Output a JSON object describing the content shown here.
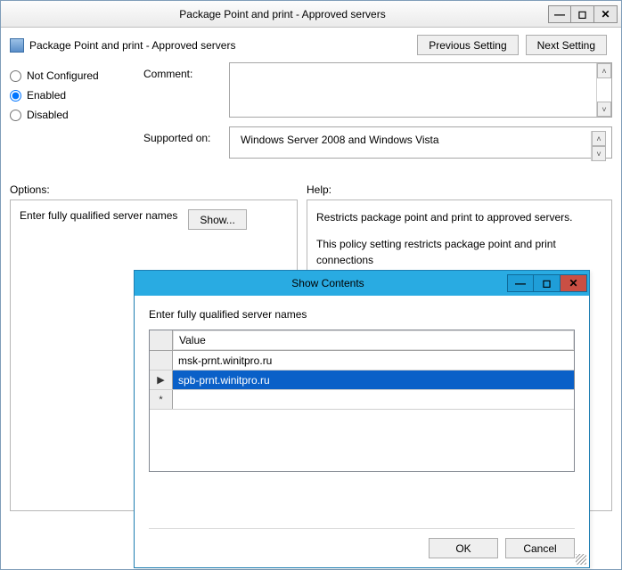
{
  "gpWindow": {
    "title": "Package Point and print - Approved servers",
    "settingName": "Package Point and print - Approved servers",
    "prevBtn": "Previous Setting",
    "nextBtn": "Next Setting",
    "radios": {
      "notConfigured": "Not Configured",
      "enabled": "Enabled",
      "disabled": "Disabled",
      "selected": "enabled"
    },
    "commentLabel": "Comment:",
    "commentValue": "",
    "supportedLabel": "Supported on:",
    "supportedValue": "Windows Server 2008 and Windows Vista",
    "optionsLabel": "Options:",
    "helpLabel": "Help:",
    "optionText": "Enter fully qualified server names",
    "showBtn": "Show...",
    "helpText1": "Restricts package point and print to approved servers.",
    "helpText2": "This policy setting restricts package point and print connections"
  },
  "modal": {
    "title": "Show Contents",
    "prompt": "Enter fully qualified server names",
    "columnHeader": "Value",
    "rows": [
      {
        "marker": "",
        "value": "msk-prnt.winitpro.ru",
        "selected": false
      },
      {
        "marker": "▶",
        "value": "spb-prnt.winitpro.ru",
        "selected": true
      },
      {
        "marker": "*",
        "value": "",
        "selected": false
      }
    ],
    "okBtn": "OK",
    "cancelBtn": "Cancel"
  }
}
